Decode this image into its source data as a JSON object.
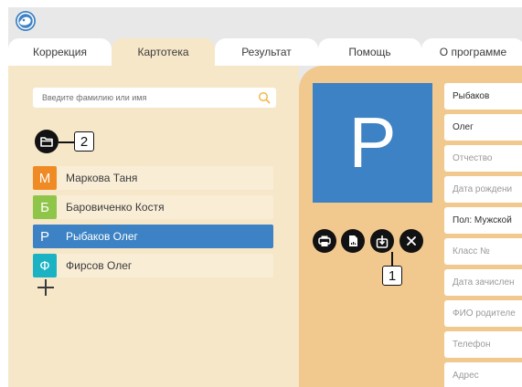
{
  "tabs": [
    {
      "label": "Коррекция",
      "active": false
    },
    {
      "label": "Картотека",
      "active": true
    },
    {
      "label": "Результат",
      "active": false
    },
    {
      "label": "Помощь",
      "active": false
    },
    {
      "label": "О программе",
      "active": false
    }
  ],
  "search": {
    "placeholder": "Введите фамилию или имя",
    "icon": "search-icon"
  },
  "callouts": {
    "one": "1",
    "two": "2"
  },
  "students": [
    {
      "initial": "М",
      "name": "Маркова Таня",
      "color": "#f08a24",
      "selected": false
    },
    {
      "initial": "Б",
      "name": "Баровиченко Костя",
      "color": "#8fc549",
      "selected": false
    },
    {
      "initial": "Р",
      "name": "Рыбаков Олег",
      "color": "#3c82c4",
      "selected": true
    },
    {
      "initial": "Ф",
      "name": "Фирсов Олег",
      "color": "#1bb3c4",
      "selected": false
    }
  ],
  "card": {
    "avatar_letter": "Р",
    "avatar_color": "#3c82c4",
    "actions": [
      "print-icon",
      "document-icon",
      "export-icon",
      "close-icon"
    ]
  },
  "form": {
    "last_name": "Рыбаков",
    "first_name": "Олег",
    "patronymic_placeholder": "Отчество",
    "birthdate_placeholder": "Дата рождени",
    "gender": "Пол: Мужской",
    "class_placeholder": "Класс №",
    "enrollment_placeholder": "Дата зачислен",
    "parent_placeholder": "ФИО родителе",
    "phone_placeholder": "Телефон",
    "address_placeholder": "Адрес"
  },
  "colors": {
    "accent": "#3c82c4",
    "left_panel": "#f6e7c9",
    "right_panel": "#f1c98f"
  }
}
